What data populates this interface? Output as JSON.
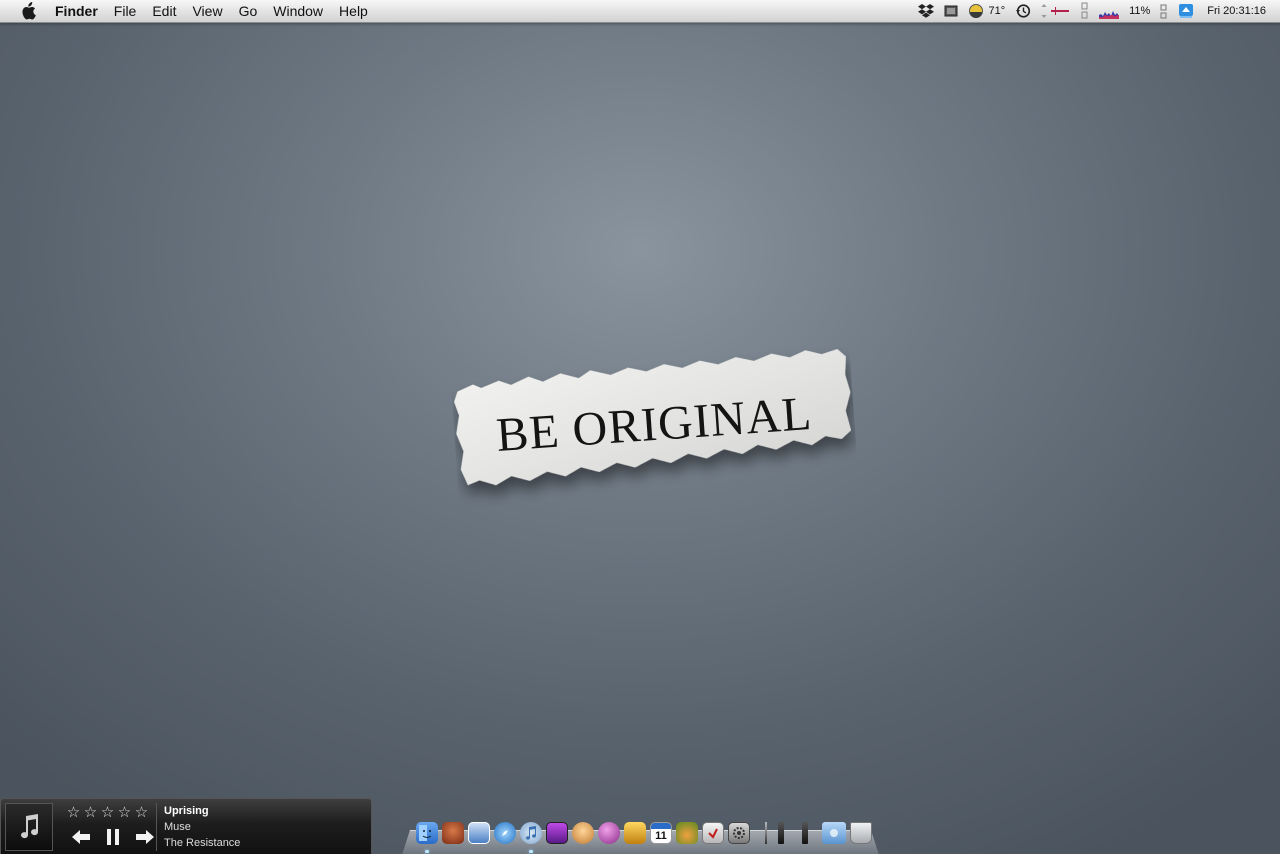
{
  "menubar": {
    "app_name": "Finder",
    "menus": [
      "File",
      "Edit",
      "View",
      "Go",
      "Window",
      "Help"
    ],
    "temperature": "71°",
    "battery_percent": "11%",
    "clock": "Fri 20:31:16",
    "status_icons": [
      "dropbox-icon",
      "display-icon",
      "weather-icon",
      "time-machine-icon",
      "network-monitor-icon",
      "disk-monitor-icon",
      "cpu-graph-icon",
      "bluetooth-monitor-icon",
      "airport-icon"
    ]
  },
  "wallpaper": {
    "text": "BE ORIGINAL"
  },
  "itunes_widget": {
    "rating_max": 5,
    "rating": 0,
    "stars": [
      "☆",
      "☆",
      "☆",
      "☆",
      "☆"
    ],
    "track": "Uprising",
    "artist": "Muse",
    "album": "The Resistance",
    "state": "playing"
  },
  "dock": {
    "apps": [
      {
        "name": "finder-icon",
        "color": "#3b7fd6"
      },
      {
        "name": "fetch-icon",
        "color": "#a04a2a"
      },
      {
        "name": "preview-icon",
        "color": "#4a7fc4"
      },
      {
        "name": "safari-icon",
        "color": "#2f8fd8"
      },
      {
        "name": "itunes-icon",
        "color": "#7fa6d0"
      },
      {
        "name": "photo-app-icon",
        "color": "#8e2fb8"
      },
      {
        "name": "adium-icon",
        "color": "#d08a40"
      },
      {
        "name": "orb-icon",
        "color": "#b04aa8"
      },
      {
        "name": "transmission-icon",
        "color": "#e0a020"
      },
      {
        "name": "ical-icon",
        "color": "#ffffff",
        "label": "11"
      },
      {
        "name": "cocktail-icon",
        "color": "#c86a2a"
      },
      {
        "name": "script-icon",
        "color": "#d0d0d0"
      },
      {
        "name": "system-preferences-icon",
        "color": "#9a9a9a"
      }
    ],
    "extras": [
      {
        "name": "stack-1-icon",
        "color": "#222222"
      },
      {
        "name": "stack-2-icon",
        "color": "#222222"
      },
      {
        "name": "downloads-folder-icon",
        "color": "#7aaee0"
      },
      {
        "name": "trash-icon",
        "color": "#c8ccd0"
      }
    ]
  }
}
